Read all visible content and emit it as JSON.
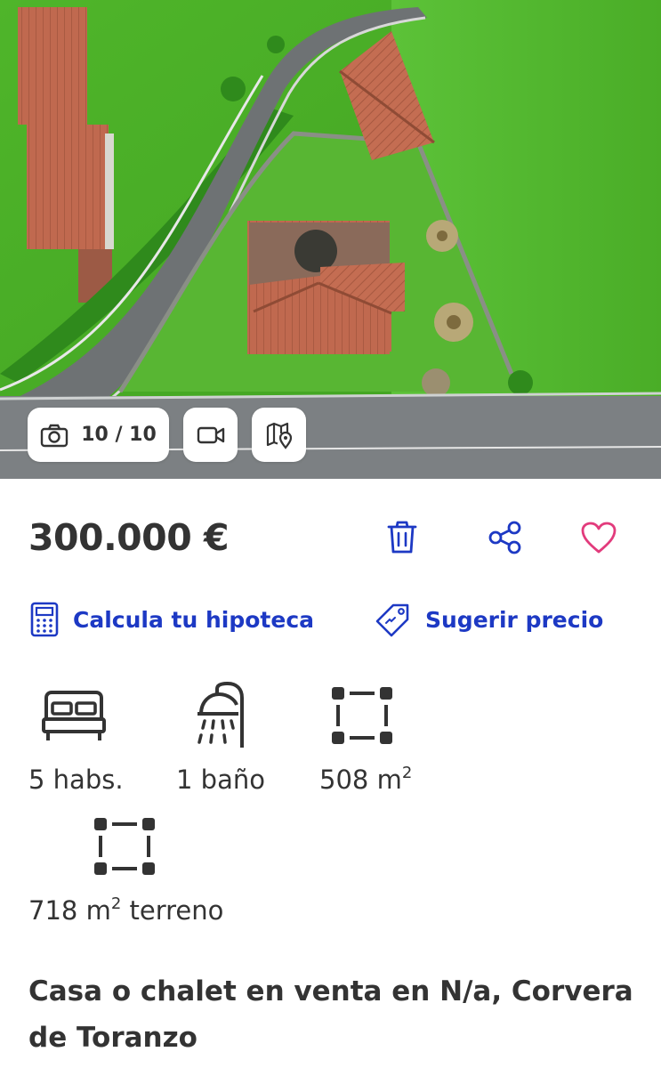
{
  "gallery": {
    "photo_counter": "10 / 10",
    "image_description_icon": "aerial-photo"
  },
  "listing": {
    "price": "300.000 €",
    "actions": {
      "delete_icon": "trash-icon",
      "share_icon": "share-icon",
      "favorite_icon": "heart-icon"
    },
    "links": {
      "mortgage": "Calcula tu hipoteca",
      "suggest_price": "Sugerir precio"
    },
    "features": {
      "rooms": "5 habs.",
      "baths": "1 baño",
      "built_area_value": "508 m",
      "built_area_sup": "2",
      "plot_value": "718 m",
      "plot_sup": "2",
      "plot_suffix": " terreno"
    },
    "title": "Casa o chalet en venta en N/a, Corvera de Toranzo"
  },
  "colors": {
    "accent": "#1d39c4",
    "favorite": "#e23b7c",
    "text": "#333333"
  }
}
